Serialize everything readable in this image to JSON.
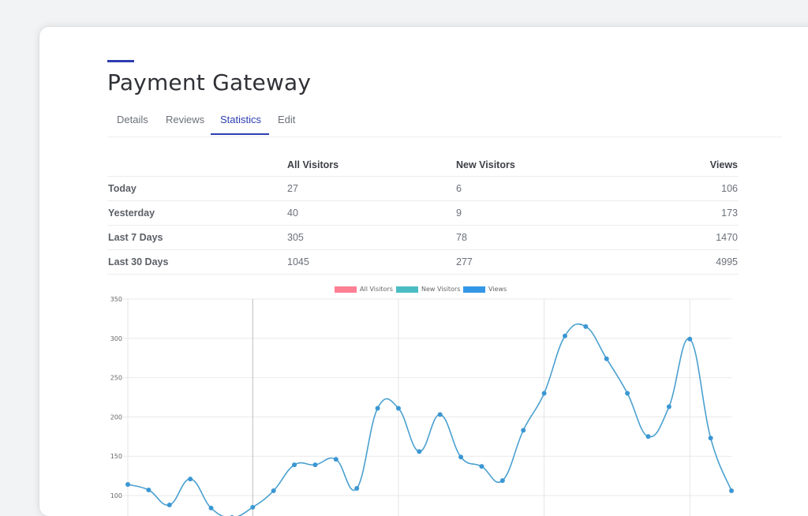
{
  "page": {
    "title": "Payment Gateway"
  },
  "tabs": [
    {
      "label": "Details"
    },
    {
      "label": "Reviews"
    },
    {
      "label": "Statistics",
      "active": true
    },
    {
      "label": "Edit"
    }
  ],
  "stats_table": {
    "headers": [
      "",
      "All Visitors",
      "New Visitors",
      "Views"
    ],
    "rows": [
      {
        "label": "Today",
        "all_visitors": "27",
        "new_visitors": "6",
        "views": "106"
      },
      {
        "label": "Yesterday",
        "all_visitors": "40",
        "new_visitors": "9",
        "views": "173"
      },
      {
        "label": "Last 7 Days",
        "all_visitors": "305",
        "new_visitors": "78",
        "views": "1470"
      },
      {
        "label": "Last 30 Days",
        "all_visitors": "1045",
        "new_visitors": "277",
        "views": "4995"
      }
    ]
  },
  "colors": {
    "accent": "#2d3eb0",
    "all_visitors": "#ff7f93",
    "new_visitors": "#4bbcc4",
    "views": "#3497e6",
    "line": "#4aa0cf"
  },
  "chart_data": {
    "type": "line",
    "legend": [
      "All Visitors",
      "New Visitors",
      "Views"
    ],
    "legend_placement": "top-center",
    "grid": true,
    "yticks": [
      "350",
      "300",
      "250",
      "200",
      "150",
      "100"
    ],
    "ylim": [
      100,
      350
    ],
    "series": [
      {
        "name": "Views",
        "values": [
          114,
          107,
          88,
          121,
          84,
          72,
          85,
          106,
          139,
          139,
          146,
          109,
          211,
          211,
          156,
          203,
          149,
          137,
          119,
          183,
          230,
          303,
          315,
          274,
          230,
          175,
          213,
          299,
          173,
          106
        ]
      }
    ]
  }
}
